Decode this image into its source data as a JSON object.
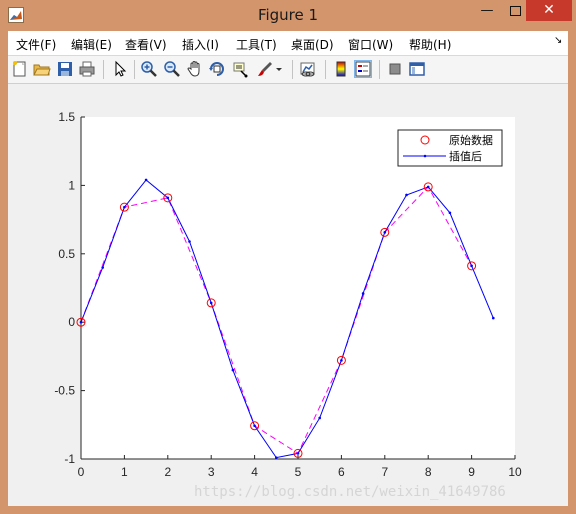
{
  "window": {
    "title": "Figure 1",
    "min_glyph": "—",
    "close_glyph": "✕"
  },
  "menu": {
    "items": [
      "文件(F)",
      "编辑(E)",
      "查看(V)",
      "插入(I)",
      "工具(T)",
      "桌面(D)",
      "窗口(W)",
      "帮助(H)"
    ],
    "overflow_glyph": "↘"
  },
  "toolbar": {
    "icons": [
      "new-figure-icon",
      "open-icon",
      "save-icon",
      "print-icon",
      "pointer-icon",
      "zoom-in-icon",
      "zoom-out-icon",
      "pan-icon",
      "rotate-3d-icon",
      "data-cursor-icon",
      "brush-icon",
      "brush-dropdown-icon",
      "link-plot-icon",
      "colorbar-icon",
      "legend-icon",
      "hide-plot-tools-icon",
      "show-plot-tools-icon"
    ]
  },
  "watermark": "https://blog.csdn.net/weixin_41649786",
  "chart_data": {
    "type": "line",
    "title": "",
    "xlabel": "",
    "ylabel": "",
    "xlim": [
      0,
      10
    ],
    "ylim": [
      -1,
      1.5
    ],
    "xticks": [
      "0",
      "1",
      "2",
      "3",
      "4",
      "5",
      "6",
      "7",
      "8",
      "9",
      "10"
    ],
    "yticks": [
      "1.5",
      "1",
      "0.5",
      "0",
      "-0.5",
      "-1"
    ],
    "legend_position": "top-right",
    "grid": false,
    "colors": {
      "original": "#ff0000",
      "dashed": "#ff00ff",
      "interp": "#0000ff"
    },
    "series": [
      {
        "name": "原始数据",
        "style": "circle-markers",
        "x": [
          0,
          1,
          2,
          3,
          4,
          5,
          6,
          7,
          8,
          9
        ],
        "y": [
          0,
          0.841,
          0.909,
          0.141,
          -0.757,
          -0.959,
          -0.279,
          0.657,
          0.989,
          0.412
        ]
      },
      {
        "name": "",
        "style": "dashed-line",
        "x": [
          0,
          1,
          2,
          3,
          4,
          5,
          6,
          7,
          8,
          9
        ],
        "y": [
          0,
          0.841,
          0.909,
          0.141,
          -0.757,
          -0.959,
          -0.279,
          0.657,
          0.989,
          0.412
        ]
      },
      {
        "name": "插值后",
        "style": "line-dot-markers",
        "x": [
          0,
          0.5,
          1,
          1.5,
          2,
          2.5,
          3,
          3.5,
          4,
          4.5,
          5,
          5.5,
          6,
          6.5,
          7,
          7.5,
          8,
          8.5,
          9,
          9.5
        ],
        "y": [
          0,
          0.4,
          0.841,
          1.04,
          0.909,
          0.59,
          0.141,
          -0.35,
          -0.757,
          -0.99,
          -0.959,
          -0.7,
          -0.279,
          0.21,
          0.657,
          0.93,
          0.989,
          0.8,
          0.412,
          0.03
        ]
      }
    ]
  }
}
